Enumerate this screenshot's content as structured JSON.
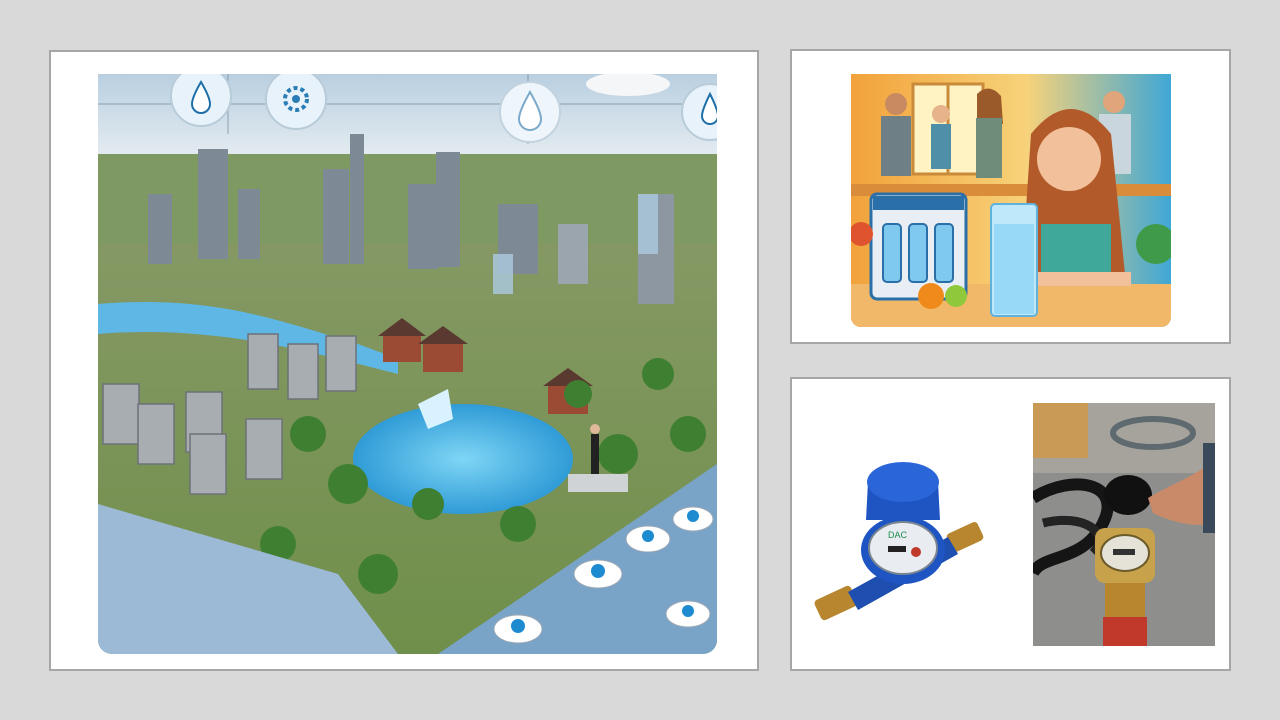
{
  "slide": {
    "background": "#d9d9d9",
    "panel_border": "#a6a6a6"
  },
  "images": {
    "city": {
      "icons": [
        "water-drop-icon",
        "gear-icon",
        "water-drop-icon",
        "water-drop-icon"
      ]
    },
    "kitchen": {},
    "meter": {
      "brand_text": "DAC"
    },
    "install": {}
  }
}
